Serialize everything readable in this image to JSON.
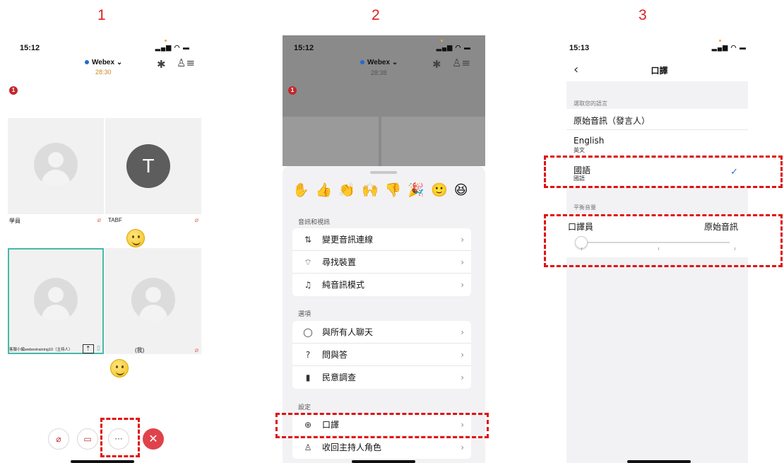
{
  "steps": [
    "1",
    "2",
    "3"
  ],
  "phone1": {
    "time": "15:12",
    "app_name": "Webex",
    "timer": "28:30",
    "badge_count": "1",
    "tiles": [
      {
        "name": "學員"
      },
      {
        "name": "TABF",
        "initial": "T"
      },
      {
        "name": "客服小編webextraining10（主持人）"
      },
      {
        "name": "(我)"
      }
    ],
    "controls": {
      "more_label": "···",
      "end_label": "✕"
    }
  },
  "phone2": {
    "time": "15:12",
    "app_name": "Webex",
    "timer": "28:38",
    "badge_count": "1",
    "reactions": [
      "✋",
      "👍",
      "👏",
      "🙌",
      "👎",
      "🎉",
      "🙂",
      "😆"
    ],
    "sections": [
      {
        "label": "音訊和視訊",
        "items": [
          {
            "icon": "mic-swap-icon",
            "glyph": "⇅",
            "label": "變更音訊連線"
          },
          {
            "icon": "wifi-icon",
            "glyph": "⌔",
            "label": "尋找裝置"
          },
          {
            "icon": "audio-only-icon",
            "glyph": "♫",
            "label": "純音訊模式"
          }
        ]
      },
      {
        "label": "選項",
        "items": [
          {
            "icon": "chat-icon",
            "glyph": "◯",
            "label": "與所有人聊天"
          },
          {
            "icon": "qa-icon",
            "glyph": "?",
            "label": "問與答"
          },
          {
            "icon": "poll-icon",
            "glyph": "▮",
            "label": "民意調查"
          }
        ]
      },
      {
        "label": "設定",
        "items": [
          {
            "icon": "interpretation-icon",
            "glyph": "⊕",
            "label": "口譯"
          },
          {
            "icon": "host-role-icon",
            "glyph": "♙",
            "label": "收回主持人角色"
          }
        ]
      }
    ]
  },
  "phone3": {
    "time": "15:13",
    "title": "口譯",
    "back_glyph": "‹",
    "choose_language_label": "選取您的語言",
    "languages": [
      {
        "main": "原始音訊（發言人）",
        "sub": ""
      },
      {
        "main": "English",
        "sub": "英文"
      },
      {
        "main": "國語",
        "sub": "國語",
        "selected": true
      }
    ],
    "balance_label": "平衡音量",
    "balance_left": "口譯員",
    "balance_right": "原始音訊",
    "balance_value": 0,
    "check_glyph": "✓"
  },
  "colors": {
    "highlight": "#e01010",
    "accent": "#2a6fd6",
    "end_call": "#e0424a"
  }
}
